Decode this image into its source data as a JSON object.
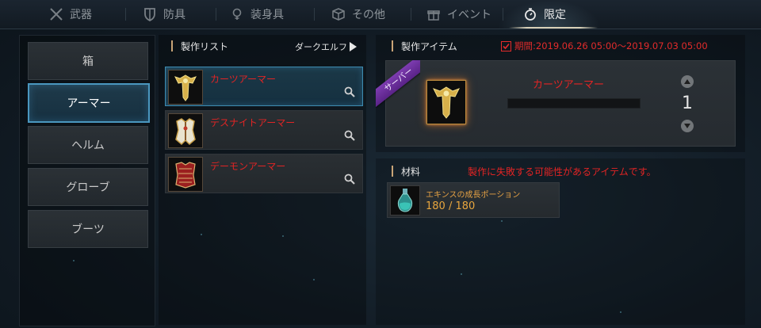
{
  "tabs": [
    {
      "label": "武器",
      "icon": "crossed-swords-icon",
      "active": false
    },
    {
      "label": "防具",
      "icon": "shield-icon",
      "active": false
    },
    {
      "label": "装身具",
      "icon": "ring-icon",
      "active": false
    },
    {
      "label": "その他",
      "icon": "box-icon",
      "active": false
    },
    {
      "label": "イベント",
      "icon": "gift-icon",
      "active": false
    },
    {
      "label": "限定",
      "icon": "stopwatch-icon",
      "active": true
    }
  ],
  "categories": [
    {
      "label": "箱",
      "active": false
    },
    {
      "label": "アーマー",
      "active": true
    },
    {
      "label": "ヘルム",
      "active": false
    },
    {
      "label": "グローブ",
      "active": false
    },
    {
      "label": "ブーツ",
      "active": false
    }
  ],
  "craft_list": {
    "title": "製作リスト",
    "filter": "ダークエルフ",
    "items": [
      {
        "name": "カーツアーマー",
        "selected": true,
        "icon": "gold-armor-icon"
      },
      {
        "name": "デスナイトアーマー",
        "selected": false,
        "icon": "white-armor-icon"
      },
      {
        "name": "デーモンアーマー",
        "selected": false,
        "icon": "red-armor-icon"
      }
    ]
  },
  "craft_item": {
    "title": "製作アイテム",
    "period": "期間:2019.06.26 05:00〜2019.07.03 05:00",
    "ribbon": "サーバー",
    "name": "カーツアーマー",
    "quantity": "1"
  },
  "materials": {
    "title": "材料",
    "warning": "製作に失敗する可能性があるアイテムです。",
    "items": [
      {
        "name": "エキンスの成長ポーション",
        "count": "180 / 180",
        "icon": "potion-icon"
      }
    ]
  },
  "colors": {
    "accent": "#4a97bf",
    "warning_red": "#e32424",
    "material_orange": "#e8a63e",
    "ribbon_purple": "#6a2c9c"
  }
}
